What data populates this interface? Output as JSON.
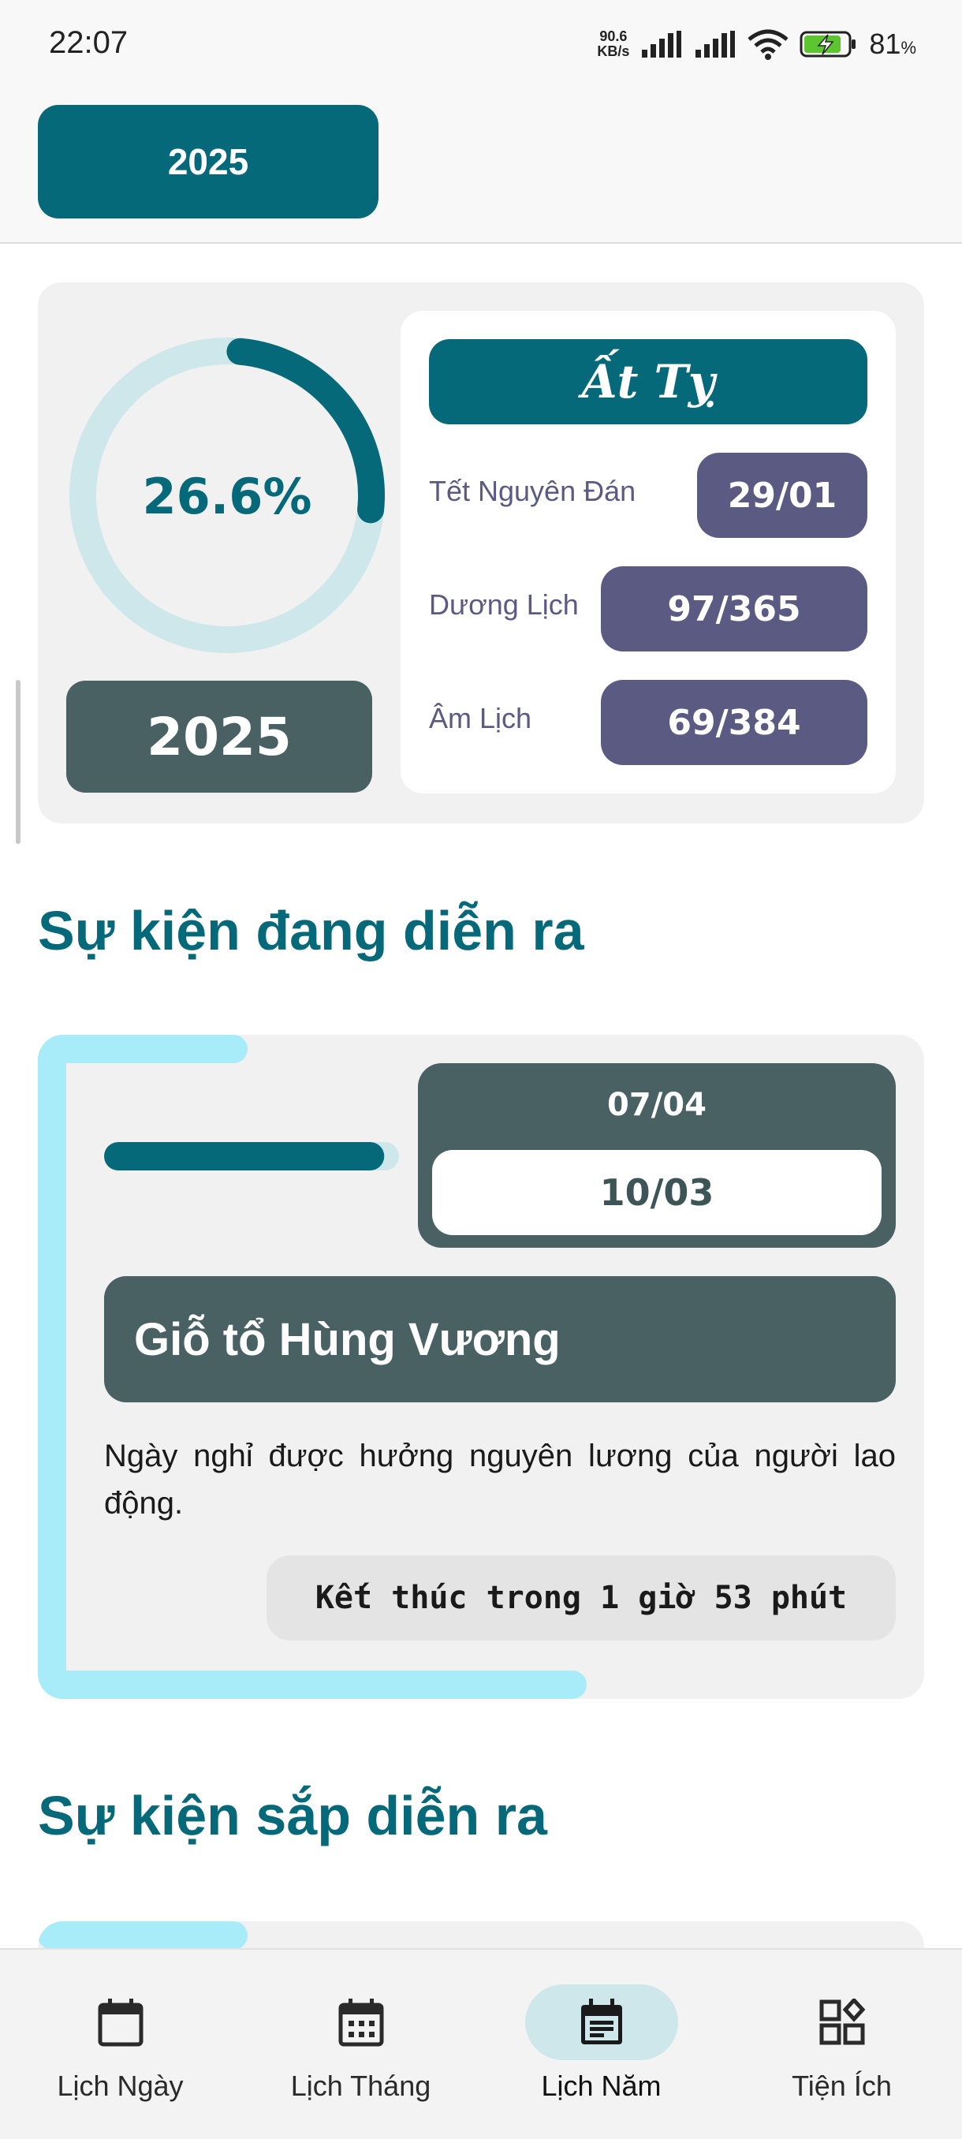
{
  "status_bar": {
    "time": "22:07",
    "net_speed_value": "90.6",
    "net_speed_unit": "KB/s",
    "battery_percent": "81",
    "battery_suffix": "%"
  },
  "header": {
    "year_button": "2025"
  },
  "summary": {
    "progress_text": "26.6%",
    "progress_fraction": 0.266,
    "year": "2025",
    "can_chi": "Ất Tỵ",
    "rows": [
      {
        "label": "Tết Nguyên Đán",
        "value": "29/01"
      },
      {
        "label": "Dương Lịch",
        "value": "97/365"
      },
      {
        "label": "Âm Lịch",
        "value": "69/384"
      }
    ]
  },
  "sections": {
    "ongoing_title": "Sự kiện đang diễn ra",
    "upcoming_title": "Sự kiện sắp diễn ra"
  },
  "ongoing_event": {
    "solar_date": "07/04",
    "lunar_date": "10/03",
    "name": "Giỗ tổ Hùng Vương",
    "description": "Ngày nghỉ được hưởng nguyên lương của người lao động.",
    "countdown": "Kết thúc trong 1 giờ 53 phút",
    "elapsed_fraction": 0.95
  },
  "bottom_nav": {
    "items": [
      {
        "label": "Lịch Ngày",
        "icon": "calendar-day-icon"
      },
      {
        "label": "Lịch Tháng",
        "icon": "calendar-month-icon"
      },
      {
        "label": "Lịch Năm",
        "icon": "calendar-year-icon",
        "active": true
      },
      {
        "label": "Tiện Ích",
        "icon": "widgets-icon"
      }
    ]
  },
  "colors": {
    "primary": "#06697a",
    "slate": "#4a6164",
    "purple": "#5a5a82",
    "accent_light": "#a8ecfa",
    "ring_track": "#cde7eb"
  }
}
